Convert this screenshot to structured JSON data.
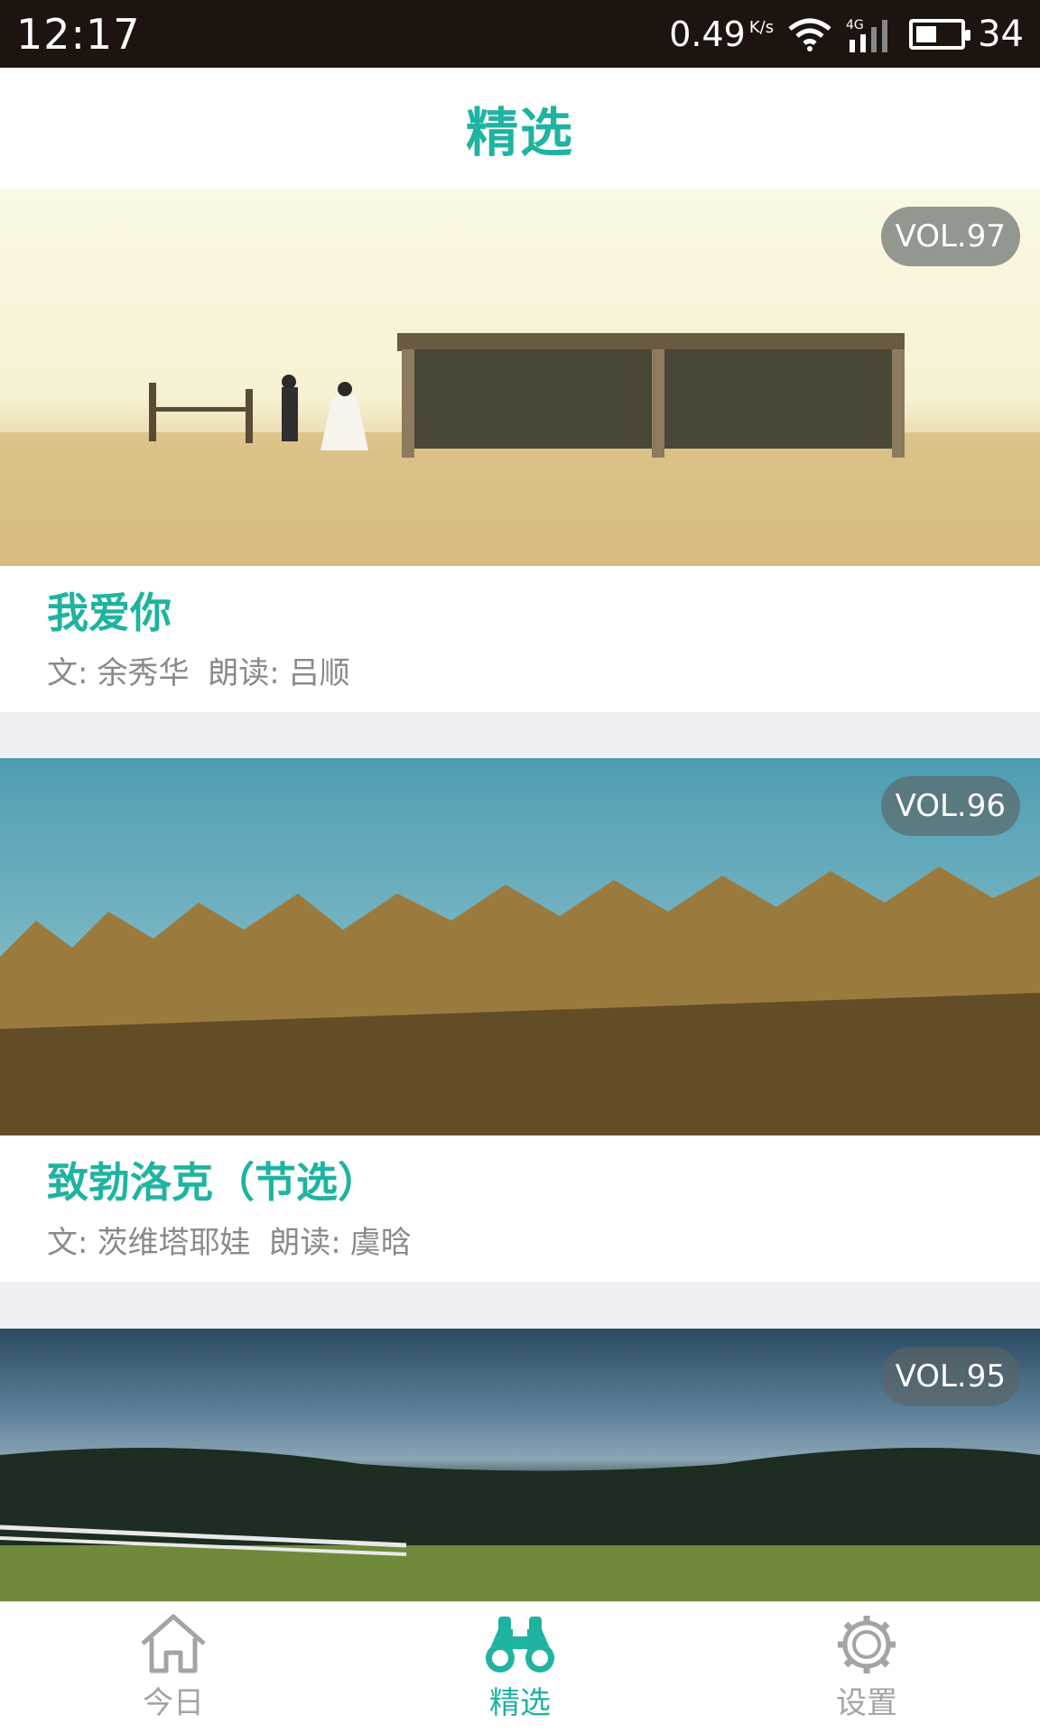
{
  "status_bar": {
    "time": "12:17",
    "net_speed": "0.49",
    "net_unit": "K/s",
    "network_type": "4G",
    "battery": "34"
  },
  "header": {
    "title": "精选"
  },
  "cards": [
    {
      "vol": "VOL.97",
      "title": "我爱你",
      "author_label": "文:",
      "author": "余秀华",
      "reader_label": "朗读:",
      "reader": "吕顺"
    },
    {
      "vol": "VOL.96",
      "title": "致勃洛克（节选）",
      "author_label": "文:",
      "author": "茨维塔耶娃",
      "reader_label": "朗读:",
      "reader": "虞晗"
    },
    {
      "vol": "VOL.95"
    }
  ],
  "nav": [
    {
      "label": "今日",
      "icon": "home-icon"
    },
    {
      "label": "精选",
      "icon": "binoculars-icon",
      "active": true
    },
    {
      "label": "设置",
      "icon": "gear-icon"
    }
  ],
  "colors": {
    "accent": "#1fb3a1",
    "status_bar": "#1d140f",
    "meta_text": "#8a8a8a",
    "background": "#eef0f3"
  }
}
